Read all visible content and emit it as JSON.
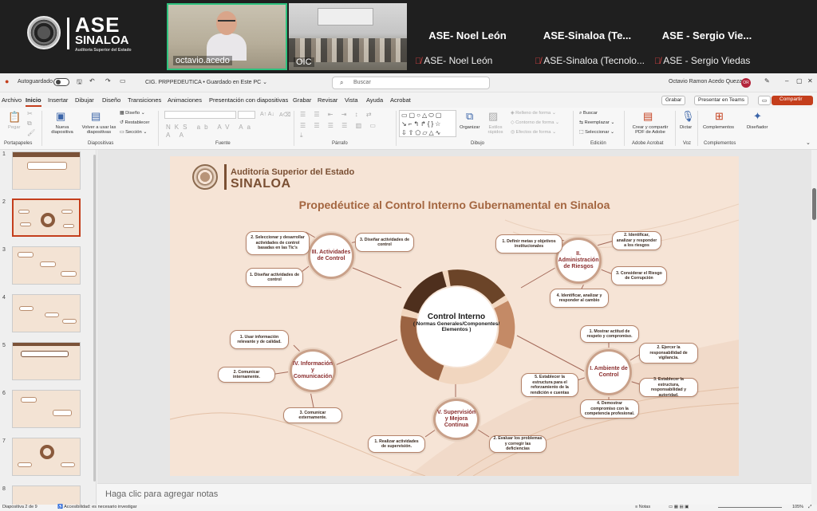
{
  "meeting": {
    "logo": {
      "line1": "ASE",
      "line2": "SINALOA",
      "line3": "Auditoría Superior del Estado"
    },
    "tiles": [
      {
        "label": "octavio.acedo"
      },
      {
        "label": "OIC"
      }
    ],
    "participants": [
      {
        "display": "ASE- Noel León",
        "caption": "ASE- Noel León"
      },
      {
        "display": "ASE-Sinaloa  (Te...",
        "caption": "ASE-Sinaloa (Tecnolo..."
      },
      {
        "display": "ASE - Sergio Vie...",
        "caption": "ASE - Sergio Viedas"
      }
    ],
    "colors": {
      "active_speaker": "#2ec27e",
      "muted": "#e04444"
    }
  },
  "titlebar": {
    "autosave": "Autoguardado",
    "filename": "CIG. PRPPEDEUTICA • Guardado en Este PC ⌄",
    "search_placeholder": "Buscar",
    "user": "Octavio Ramon Acedo Quezada",
    "initials": "OR"
  },
  "menu": {
    "items": [
      "Archivo",
      "Inicio",
      "Insertar",
      "Dibujar",
      "Diseño",
      "Transiciones",
      "Animaciones",
      "Presentación con diapositivas",
      "Grabar",
      "Revisar",
      "Vista",
      "Ayuda",
      "Acrobat"
    ],
    "active": "Inicio",
    "record": "Grabar",
    "teams": "Presentar en Teams",
    "share": "Compartir"
  },
  "ribbon": {
    "groups": [
      "Portapapeles",
      "Diapositivas",
      "Fuente",
      "Párrafo",
      "Dibujo",
      "Edición",
      "Adobe Acrobat",
      "Voz",
      "Complementos"
    ],
    "clipboard": {
      "paste": "Pegar"
    },
    "slides": {
      "new": "Nueva diapositiva",
      "reuse": "Volver a usar las diapositivas",
      "layout": "Diseño",
      "reset": "Restablecer",
      "section": "Sección"
    },
    "drawing": {
      "arrange": "Organizar",
      "styles": "Estilos rápidos",
      "fill": "Relleno de forma",
      "outline": "Contorno de forma",
      "effects": "Efectos de forma"
    },
    "editing": {
      "find": "Buscar",
      "replace": "Reemplazar",
      "select": "Seleccionar"
    },
    "acrobat": {
      "create": "Crear y compartir PDF de Adobe"
    },
    "voice": {
      "dictate": "Dictar"
    },
    "addins": {
      "addins": "Complementos",
      "designer": "Diseñador"
    }
  },
  "thumbnails": {
    "numbers": [
      "1",
      "2",
      "3",
      "4",
      "5",
      "6",
      "7",
      "8"
    ],
    "selected": 2
  },
  "slide": {
    "logo_line1": "Auditoría Superior del Estado",
    "logo_line2": "SINALOA",
    "title": "Propedéutice al Control Interno Gubernamental en Sinaloa",
    "center_title": "Control Interno",
    "center_subtitle": "( Normas Generales/Componentes/ Elementos )",
    "hubs": {
      "h1": "I. Ambiente de Control",
      "h2": "II. Administración de Riesgos",
      "h3": "III. Actividades de Control",
      "h4": "IV. Información y Comunicación",
      "h5": "V. Supervisión y Mejora Continua"
    },
    "nodes": {
      "a1": "1. Mostrar actitud de respeto y compromiso.",
      "a2": "2. Ejercer la responsabilidad de vigilancia.",
      "a3": "3. Establecer la estructura, responsabilidad y autoridad.",
      "a4": "4. Demostrar compromiso con la competencia profesional.",
      "a5": "5. Establecer la estructura para el reforzamiento de la rendición e cuentas",
      "r1": "1. Definir metas y objetivos institucionales",
      "r2": "2. Identificar, analizar y responder a los riesgos",
      "r3": "3. Considerar el Riesgo de Corrupción",
      "r4": "4. Identificar, analizar y responder al cambio",
      "c1": "1. Diseñar actividades de control",
      "c2": "2. Seleccionar y desarrollar actividades de control basadas en las Tic's",
      "c3": "3. Diseñar actividades de control",
      "i1": "1. Usar información relevante y de calidad.",
      "i2": "2. Comunicar internamente.",
      "i3": "3. Comunicar externamente.",
      "s1": "1. Realizar actividades de supervisión.",
      "s2": "2. Evaluar los problemas y corregir las deficiencias"
    },
    "colors": {
      "background": "#f6e4d6",
      "accent": "#a46640",
      "ring_dark": "#5b3a26",
      "ring_light": "#f1d6bf"
    }
  },
  "notes_placeholder": "Haga clic para agregar notas",
  "status": {
    "slide": "Diapositiva 2 de 9",
    "accessibility": "Accesibilidad: es necesario investigar",
    "notes": "Notas",
    "zoom": "105%"
  }
}
